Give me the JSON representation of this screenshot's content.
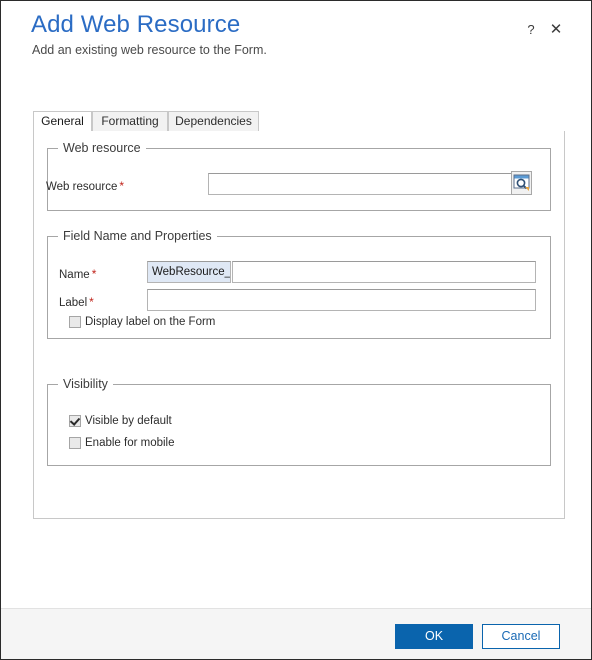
{
  "header": {
    "title": "Add Web Resource",
    "subtitle": "Add an existing web resource to the Form.",
    "help_icon": "question-mark-icon",
    "close_icon": "close-icon"
  },
  "tabs": [
    {
      "label": "General",
      "active": true
    },
    {
      "label": "Formatting",
      "active": false
    },
    {
      "label": "Dependencies",
      "active": false
    }
  ],
  "groups": {
    "web_resource": {
      "legend": "Web resource",
      "field_label": "Web resource",
      "required_marker": "*",
      "value": "",
      "lookup_icon": "lookup-search-icon"
    },
    "field_name_properties": {
      "legend": "Field Name and Properties",
      "name_label": "Name",
      "name_required_marker": "*",
      "name_prefix": "WebResource_",
      "name_value": "",
      "label_label": "Label",
      "label_required_marker": "*",
      "label_value": "",
      "display_label_checkbox": {
        "label": "Display label on the Form",
        "checked": false
      }
    },
    "visibility": {
      "legend": "Visibility",
      "visible_by_default": {
        "label": "Visible by default",
        "checked": true
      },
      "enable_for_mobile": {
        "label": "Enable for mobile",
        "checked": false
      }
    }
  },
  "footer": {
    "ok_label": "OK",
    "cancel_label": "Cancel"
  },
  "colors": {
    "title_blue": "#2b6cc4",
    "primary_button": "#0a64ad",
    "required_red": "#c0241b",
    "prefix_field_bg": "#dfe8f5"
  }
}
